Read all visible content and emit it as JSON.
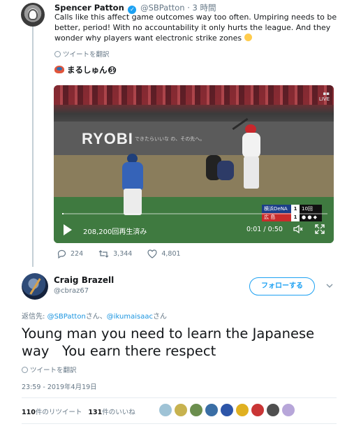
{
  "parent_tweet": {
    "author_name": "Spencer Patton",
    "author_handle": "@SBPatton",
    "separator": "·",
    "time": "3 時間",
    "text": "Calls like this affect game outcomes way too often. Umpiring needs to be better, period! With no accountability it only hurts the league. And they wonder why players want electronic strike zones",
    "translate_label": "ツイートを翻訳",
    "quoted_label": "まるしゅん",
    "quoted_label_suffix": "69",
    "video": {
      "logo": "RYOBI",
      "logo_tagline": "できたらいいな の、その先へ。",
      "views": "208,200回再生済み",
      "time": "0:01 / 0:50",
      "progress_fraction": 0.005,
      "scoreboard": {
        "team1": "横浜DeNA",
        "team1_score": "1",
        "team2": "広 島",
        "team2_score": "1",
        "inning": "10回"
      }
    },
    "actions": {
      "replies": "224",
      "retweets": "3,344",
      "likes": "4,801"
    }
  },
  "main_tweet": {
    "author_name": "Craig Brazell",
    "author_handle": "@cbraz67",
    "follow_label": "フォローする",
    "reply_prefix": "返信先: ",
    "reply_mention1": "@SBPatton",
    "reply_mid": "さん、",
    "reply_mention2": "@ikumaisaac",
    "reply_suffix": "さん",
    "text": "Young man you need to learn the Japanese way   You earn there respect",
    "translate_label": "ツイートを翻訳",
    "timestamp": "23:59 - 2019年4月19日",
    "retweet_count": "110",
    "retweet_label": "件のリツイート",
    "like_count": "131",
    "like_label": "件のいいね"
  },
  "colors": {
    "accent": "#1da1f2",
    "secondary_text": "#657786",
    "like_avatars": [
      "#9fc3d6",
      "#c7b24f",
      "#6b8e4e",
      "#3a6ea5",
      "#2d55a8",
      "#e0b020",
      "#c93535",
      "#4f4f4f",
      "#b7a6d9"
    ]
  }
}
